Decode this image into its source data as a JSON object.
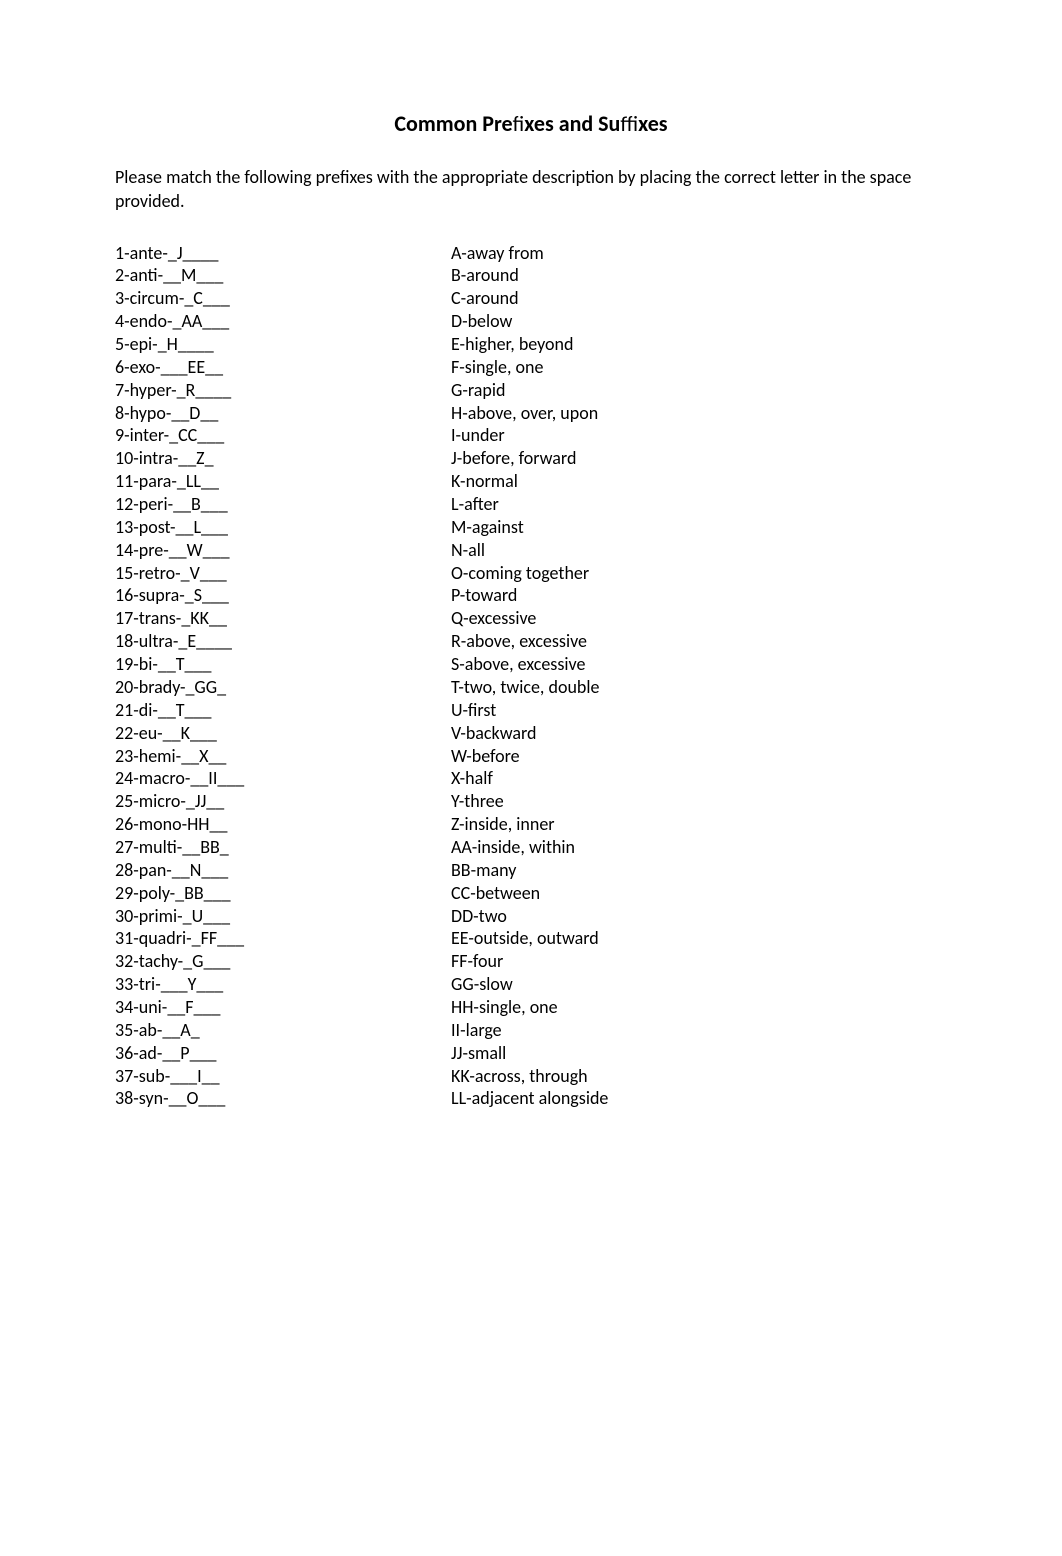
{
  "title_prefix": "Common Pre",
  "title_mid1": "fi",
  "title_mid2": "xes and Su",
  "title_mid3": "ffi",
  "title_suffix": "xes",
  "instructions": "Please match the following prefixes with the appropriate description by placing the correct letter in the space provided.",
  "left": [
    "1-ante-_J____",
    "2-anti-__M___",
    "3-circum-_C___",
    "4-endo-_AA___",
    "5-epi-_H____",
    "6-exo-___EE__",
    "7-hyper-_R____",
    "8-hypo-__D__",
    "9-inter-_CC___",
    "10-intra-__Z_",
    "11-para-_LL__",
    "12-peri-__B___",
    "13-post-__L___",
    "14-pre-__W___",
    "15-retro-_V___",
    "16-supra-_S___",
    "17-trans-_KK__",
    "18-ultra-_E____",
    "19-bi-__T___",
    "20-brady-_GG_",
    "21-di-__T___",
    "22-eu-__K___",
    "23-hemi-__X__",
    "24-macro-__II___",
    "25-micro-_JJ__",
    "26-mono-HH__",
    "27-multi-__BB_",
    "28-pan-__N___",
    "29-poly-_BB___",
    "30-primi-_U___",
    "31-quadri-_FF___",
    "32-tachy-_G___",
    "33-tri-___Y___",
    "34-uni-__F___",
    "35-ab-__A_",
    "36-ad-__P___",
    "37-sub-___I__",
    "38-syn-__O___"
  ],
  "right": [
    "A-away from",
    "B-around",
    "C-around",
    "D-below",
    "E-higher, beyond",
    "F-single, one",
    "G-rapid",
    "H-above, over, upon",
    "I-under",
    "J-before, forward",
    "K-normal",
    "L-after",
    "M-against",
    "N-all",
    "O-coming together",
    "P-toward",
    "Q-excessive",
    "R-above, excessive",
    "S-above, excessive",
    "T-two, twice, double",
    "U-first",
    "V-backward",
    "W-before",
    "X-half",
    "Y-three",
    "Z-inside, inner",
    "AA-inside, within",
    "BB-many",
    "CC-between",
    "DD-two",
    "EE-outside, outward",
    "FF-four",
    "GG-slow",
    "HH-single, one",
    "II-large",
    "JJ-small",
    "KK-across, through",
    "LL-adjacent alongside"
  ]
}
